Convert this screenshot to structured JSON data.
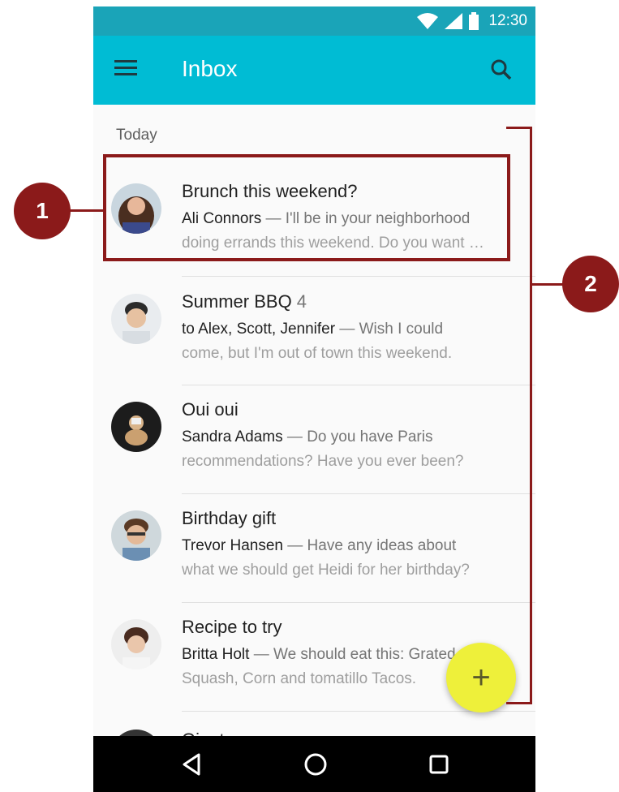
{
  "status": {
    "time": "12:30",
    "wifi_icon": "wifi-icon",
    "signal_icon": "signal-icon",
    "battery_icon": "battery-icon"
  },
  "appbar": {
    "title": "Inbox",
    "menu_icon": "menu-icon",
    "search_icon": "search-icon",
    "color": "#00bcd4"
  },
  "section_label": "Today",
  "emails": [
    {
      "subject": "Brunch this weekend?",
      "count": "",
      "sender": "Ali Connors",
      "preview1": " — I'll be in your neighborhood",
      "preview2": "doing errands this weekend. Do you want …"
    },
    {
      "subject": "Summer BBQ",
      "count": "4",
      "sender": "to Alex, Scott, Jennifer",
      "preview1": " — Wish I could",
      "preview2": "come, but I'm out of town this weekend."
    },
    {
      "subject": "Oui oui",
      "count": "",
      "sender": "Sandra Adams",
      "preview1": " — Do you have Paris",
      "preview2": "recommendations? Have you ever been?"
    },
    {
      "subject": "Birthday gift",
      "count": "",
      "sender": "Trevor Hansen",
      "preview1": " — Have any ideas about",
      "preview2": "what we should get Heidi for her birthday?"
    },
    {
      "subject": "Recipe to try",
      "count": "",
      "sender": "Britta Holt",
      "preview1": " — We should eat this: Grated",
      "preview2": "Squash, Corn and tomatillo Tacos."
    },
    {
      "subject": "Giants game",
      "count": "",
      "sender": "",
      "preview1": "",
      "preview2": ""
    }
  ],
  "fab": {
    "label": "+",
    "color": "#eef03a"
  },
  "callouts": {
    "one": "1",
    "two": "2",
    "color": "#8b1a1a"
  }
}
